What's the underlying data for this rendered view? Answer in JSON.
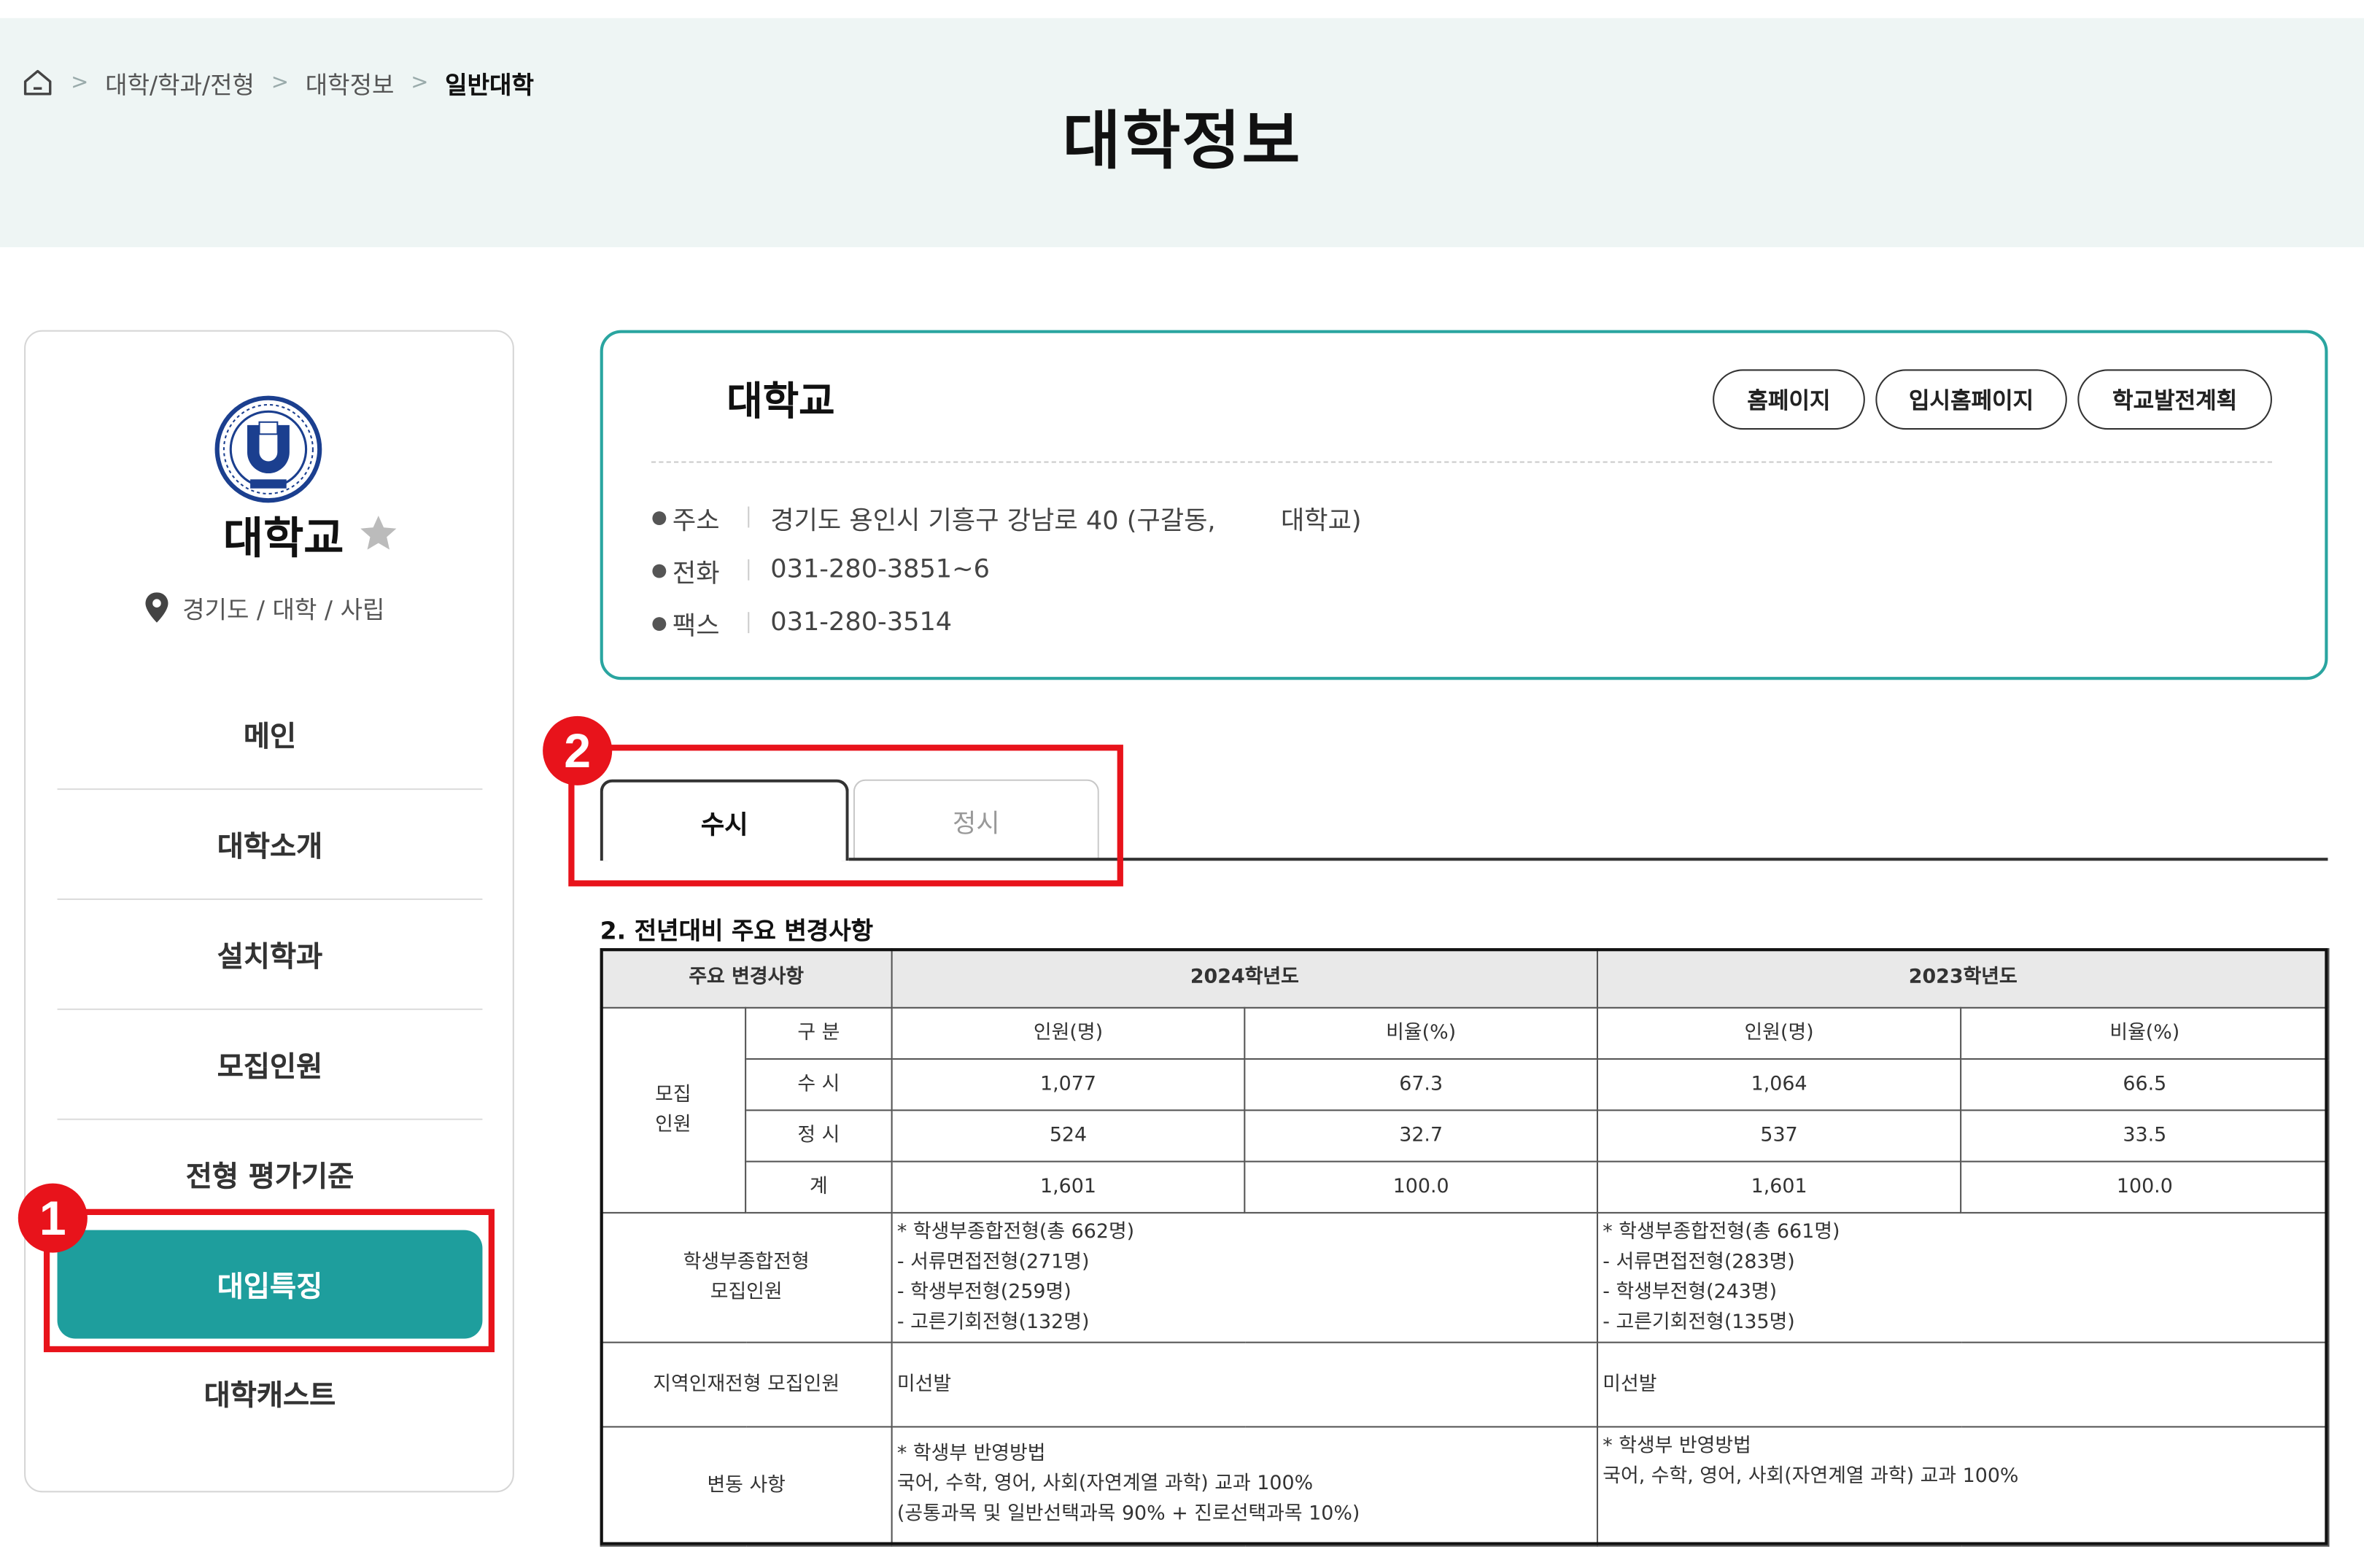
{
  "breadcrumb": {
    "items": [
      "대학/학과/전형",
      "대학정보"
    ],
    "current": "일반대학"
  },
  "page": {
    "title": "대학정보"
  },
  "sidebar": {
    "name": "대학교",
    "location": "경기도 / 대학 / 사립",
    "menu": [
      {
        "label": "메인"
      },
      {
        "label": "대학소개"
      },
      {
        "label": "설치학과"
      },
      {
        "label": "모집인원"
      },
      {
        "label": "전형 평가기준"
      },
      {
        "label": "대입특징",
        "active": true
      },
      {
        "label": "대학캐스트"
      }
    ]
  },
  "card": {
    "title": "대학교",
    "buttons": {
      "home": "홈페이지",
      "admission": "입시홈페이지",
      "plan": "학교발전계획"
    },
    "address_label": "주소",
    "address": "경기도 용인시 기흥구 강남로 40 (구갈동,        대학교)",
    "phone_label": "전화",
    "phone": "031-280-3851~6",
    "fax_label": "팩스",
    "fax": "031-280-3514"
  },
  "tabs": {
    "early": "수시",
    "regular": "정시",
    "active": "early"
  },
  "annotations": {
    "one": "1",
    "two": "2"
  },
  "section": {
    "title": "2. 전년대비 주요 변경사항"
  },
  "table": {
    "col_main": "주요 변경사항",
    "year_2024": "2024학년도",
    "year_2023": "2023학년도",
    "sub_category": "구 분",
    "sub_count": "인원(명)",
    "sub_ratio": "비율(%)",
    "group_label": "모집\n인원",
    "rows": [
      {
        "label": "수 시",
        "c24": "1,077",
        "r24": "67.3",
        "c23": "1,064",
        "r23": "66.5"
      },
      {
        "label": "정 시",
        "c24": "524",
        "r24": "32.7",
        "c23": "537",
        "r23": "33.5"
      },
      {
        "label": "계",
        "c24": "1,601",
        "r24": "100.0",
        "c23": "1,601",
        "r23": "100.0"
      }
    ],
    "student_label": "학생부종합전형\n모집인원",
    "student_2024": "* 학생부종합전형(총 662명)\n- 서류면접전형(271명)\n- 학생부전형(259명)\n- 고른기회전형(132명)",
    "student_2023": "* 학생부종합전형(총 661명)\n- 서류면접전형(283명)\n- 학생부전형(243명)\n- 고른기회전형(135명)",
    "regional_label": "지역인재전형 모집인원",
    "regional_2024": "미선발",
    "regional_2023": "미선발",
    "change_label": "변동 사항",
    "change_2024": "* 학생부 반영방법\n국어, 수학, 영어, 사회(자연계열 과학) 교과 100%\n(공통과목 및 일반선택과목 90% + 진로선택과목 10%)",
    "change_2023": "* 학생부 반영방법\n국어, 수학, 영어, 사회(자연계열 과학) 교과 100%"
  },
  "colors": {
    "accent": "#1e9e9d",
    "card_border": "#2aa5a0",
    "annotation": "#e8131b",
    "header_bg": "#eef5f4"
  }
}
